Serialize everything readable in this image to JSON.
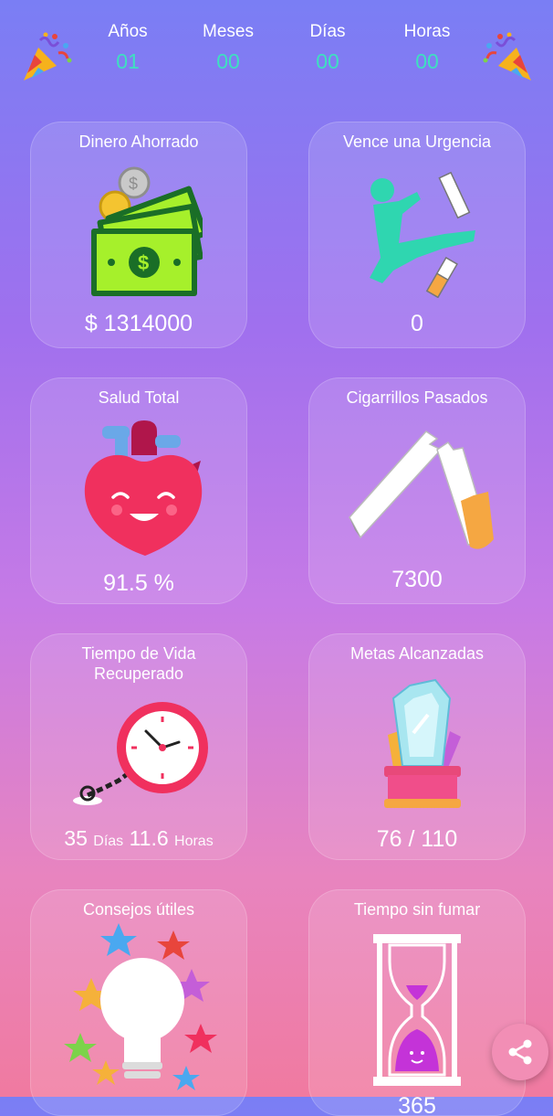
{
  "counters": [
    {
      "label": "Años",
      "value": "01"
    },
    {
      "label": "Meses",
      "value": "00"
    },
    {
      "label": "Días",
      "value": "00"
    },
    {
      "label": "Horas",
      "value": "00"
    }
  ],
  "cards": {
    "money": {
      "title": "Dinero Ahorrado",
      "value": "$ 1314000",
      "icon": "money-stack-icon"
    },
    "urge": {
      "title": "Vence una Urgencia",
      "value": "0",
      "icon": "kick-cigarette-icon"
    },
    "health": {
      "title": "Salud Total",
      "value": "91.5 %",
      "icon": "heart-icon"
    },
    "cigs": {
      "title": "Cigarrillos Pasados",
      "value": "7300",
      "icon": "broken-cigarette-icon"
    },
    "life": {
      "title_line1": "Tiempo de Vida",
      "title_line2": "Recuperado",
      "days_value": "35",
      "days_unit": "Días",
      "hours_value": "11.6",
      "hours_unit": "Horas",
      "icon": "chained-clock-icon"
    },
    "goals": {
      "title": "Metas Alcanzadas",
      "value": "76 / 110",
      "icon": "trophy-crystal-icon"
    },
    "tips": {
      "title": "Consejos útiles",
      "icon": "light-bulb-icon"
    },
    "smokefree": {
      "title": "Tiempo sin fumar",
      "value": "365",
      "icon": "hourglass-icon"
    }
  },
  "colors": {
    "accent": "#3ee0c0",
    "share_button": "#f28eb5"
  }
}
